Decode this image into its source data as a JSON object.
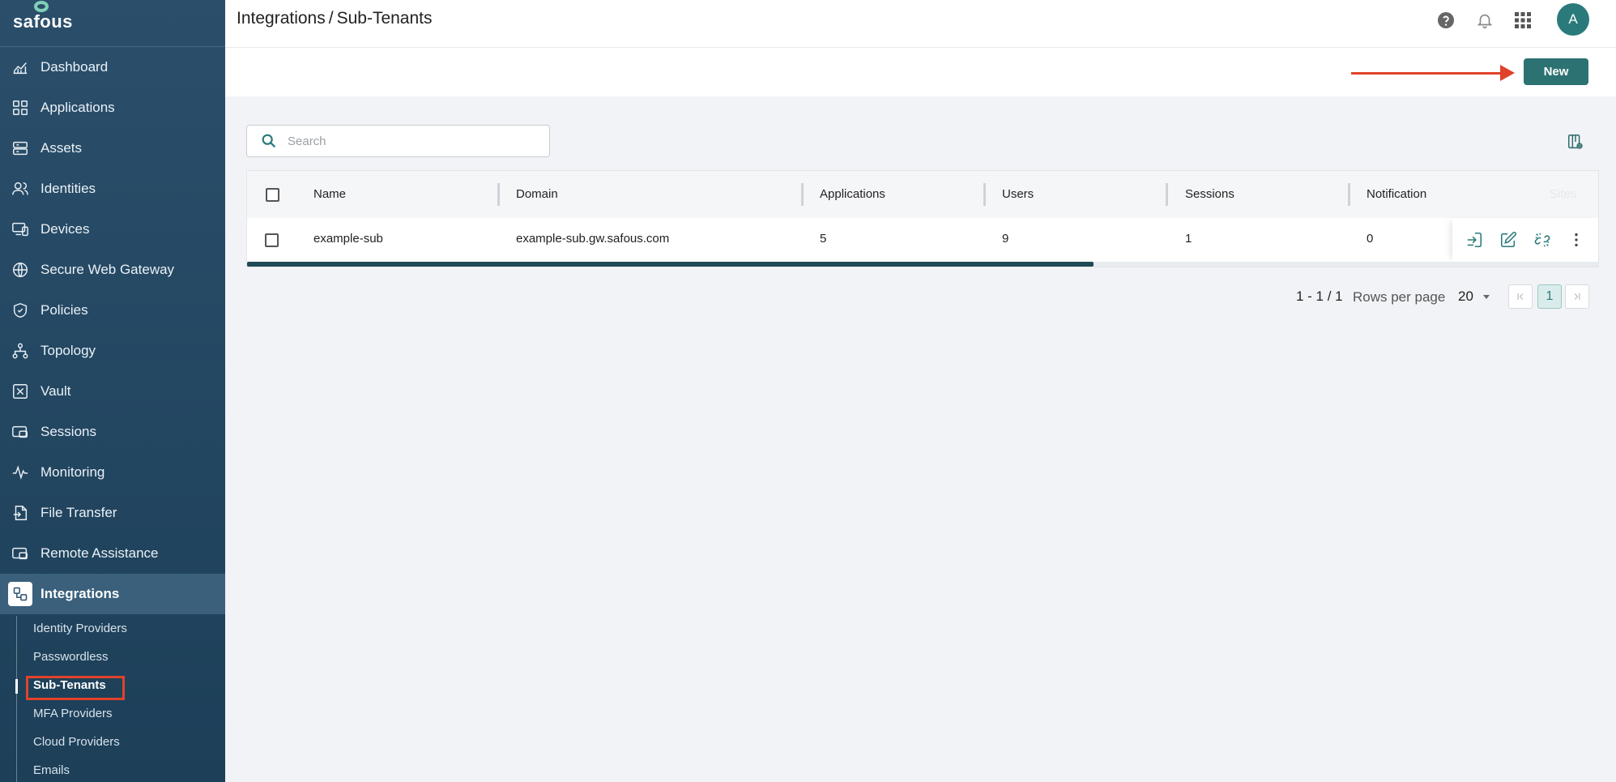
{
  "app": {
    "logo_text": "safous"
  },
  "breadcrumb": {
    "parent": "Integrations",
    "separator": "/",
    "current": "Sub-Tenants"
  },
  "header": {
    "avatar_initial": "A"
  },
  "sidebar": {
    "items": [
      {
        "label": "Dashboard",
        "icon": "chart-icon"
      },
      {
        "label": "Applications",
        "icon": "grid-icon"
      },
      {
        "label": "Assets",
        "icon": "server-icon"
      },
      {
        "label": "Identities",
        "icon": "users-icon"
      },
      {
        "label": "Devices",
        "icon": "devices-icon"
      },
      {
        "label": "Secure Web Gateway",
        "icon": "globe-icon"
      },
      {
        "label": "Policies",
        "icon": "shield-icon"
      },
      {
        "label": "Topology",
        "icon": "topology-icon"
      },
      {
        "label": "Vault",
        "icon": "vault-icon"
      },
      {
        "label": "Sessions",
        "icon": "sessions-icon"
      },
      {
        "label": "Monitoring",
        "icon": "pulse-icon"
      },
      {
        "label": "File Transfer",
        "icon": "file-transfer-icon"
      },
      {
        "label": "Remote Assistance",
        "icon": "remote-icon"
      },
      {
        "label": "Integrations",
        "icon": "integrations-icon",
        "active": true
      }
    ],
    "sub_items": [
      {
        "label": "Identity Providers"
      },
      {
        "label": "Passwordless"
      },
      {
        "label": "Sub-Tenants",
        "active": true
      },
      {
        "label": "MFA Providers"
      },
      {
        "label": "Cloud Providers"
      },
      {
        "label": "Emails"
      }
    ]
  },
  "toolbar": {
    "new_label": "New"
  },
  "search": {
    "placeholder": "Search",
    "value": ""
  },
  "table": {
    "columns": [
      "Name",
      "Domain",
      "Applications",
      "Users",
      "Sessions",
      "Notification",
      "Sites"
    ],
    "rows": [
      {
        "name": "example-sub",
        "domain": "example-sub.gw.safous.com",
        "applications": "5",
        "users": "9",
        "sessions": "1",
        "notification": "0"
      }
    ]
  },
  "pagination": {
    "range": "1 - 1 / 1",
    "rows_per_page_label": "Rows per page",
    "rows_per_page": "20",
    "current_page": "1"
  },
  "colors": {
    "sidebar_bg": "#2b4f6b",
    "accent": "#2d7272",
    "annotation_red": "#e0432a"
  }
}
